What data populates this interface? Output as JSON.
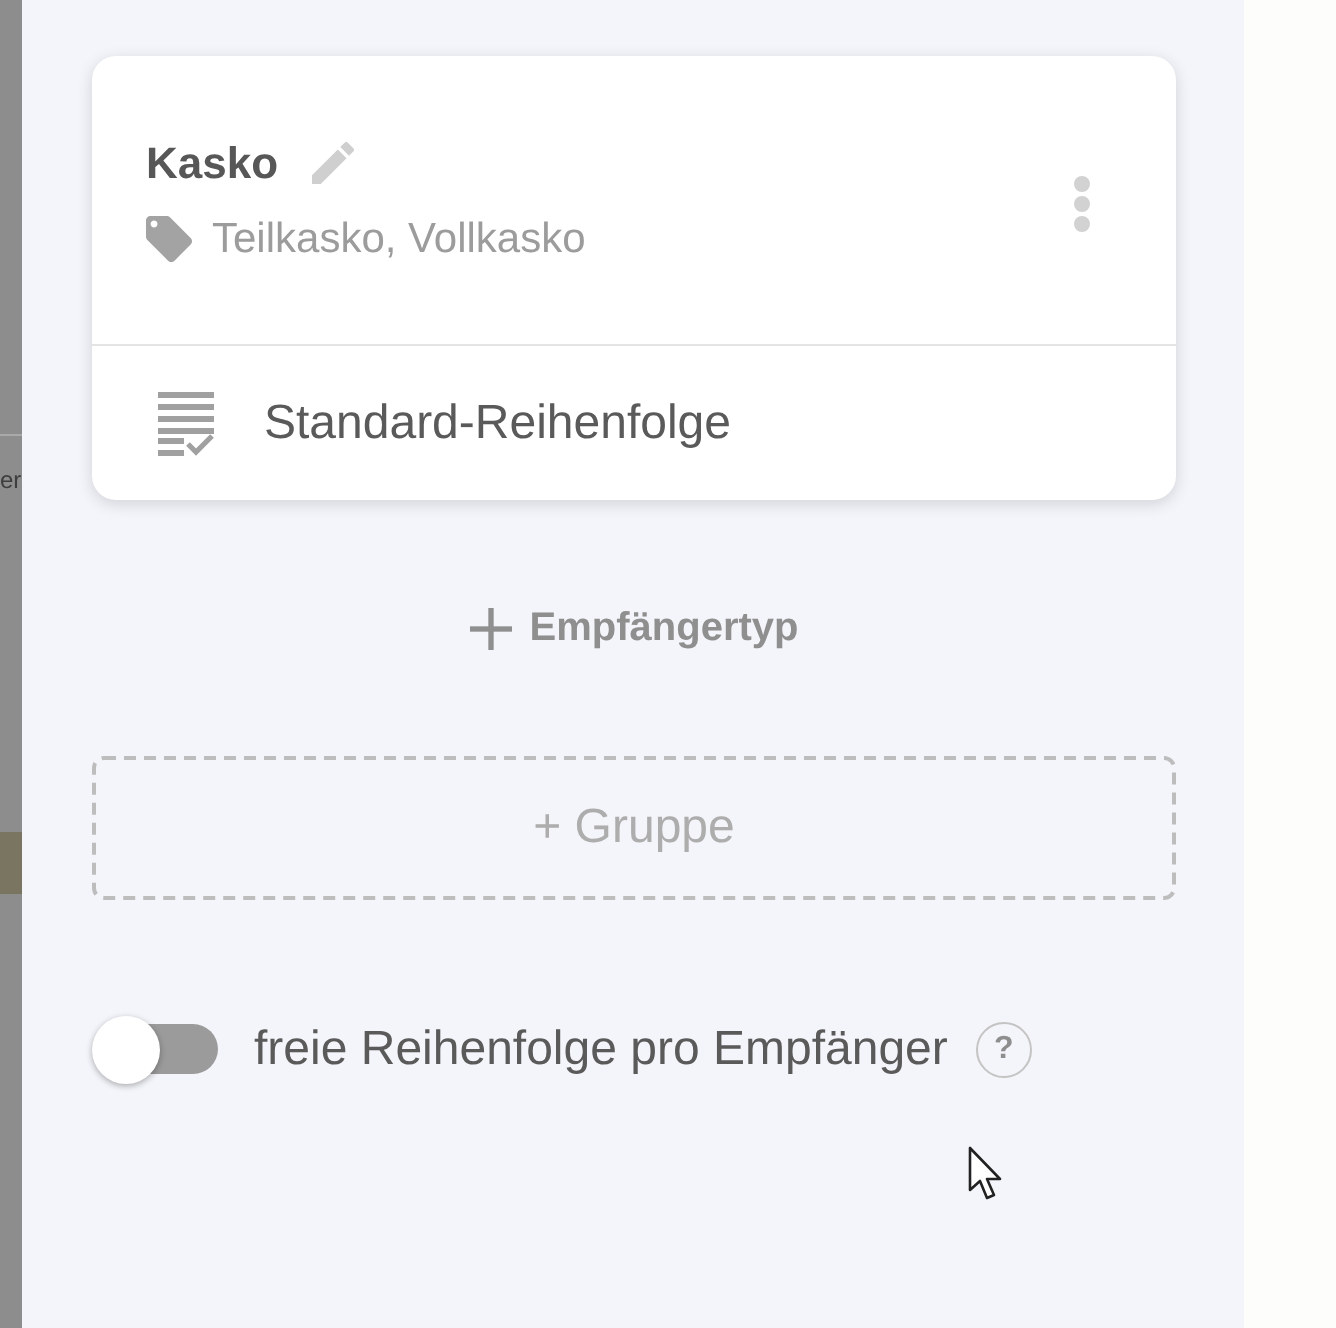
{
  "backdrop": {
    "text": "er"
  },
  "card": {
    "title": "Kasko",
    "tags": "Teilkasko, Vollkasko",
    "order": "Standard-Reihenfolge"
  },
  "add_recipient_type": {
    "label": "Empfängertyp"
  },
  "add_group": {
    "label": "+ Gruppe"
  },
  "toggle": {
    "label": "freie Reihenfolge pro Empfänger",
    "on": false,
    "help": "?"
  }
}
